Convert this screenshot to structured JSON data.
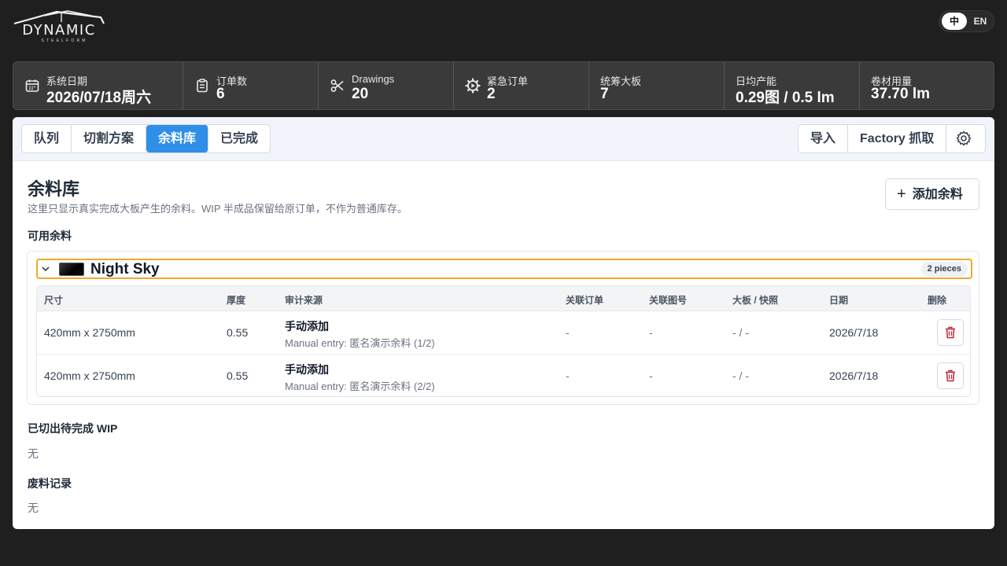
{
  "brand": {
    "name": "DYNAMIC",
    "sub": "STEELFORM"
  },
  "language": {
    "zh": "中",
    "en": "EN",
    "selected": "中"
  },
  "stats": [
    {
      "label": "系统日期",
      "value": "2026/07/18周六",
      "icon": "calendar-icon"
    },
    {
      "label": "订单数",
      "value": "6",
      "icon": "clipboard-icon"
    },
    {
      "label": "Drawings",
      "value": "20",
      "icon": "scissors-icon"
    },
    {
      "label": "紧急订单",
      "value": "2",
      "icon": "alert-gear-icon"
    },
    {
      "label": "统筹大板",
      "value": "7",
      "icon": ""
    },
    {
      "label": "日均产能",
      "value": "0.29图 / 0.5 lm",
      "icon": ""
    },
    {
      "label": "卷材用量",
      "value": "37.70 lm",
      "icon": ""
    }
  ],
  "tabs": [
    {
      "label": "队列",
      "active": false
    },
    {
      "label": "切割方案",
      "active": false
    },
    {
      "label": "余料库",
      "active": true
    },
    {
      "label": "已完成",
      "active": false
    }
  ],
  "actions": {
    "import": "导入",
    "factory": "Factory 抓取",
    "settings_icon": "gear-icon"
  },
  "page": {
    "title": "余料库",
    "description": "这里只显示真实完成大板产生的余料。WIP 半成品保留给原订单，不作为普通库存。",
    "add_button": "添加余料"
  },
  "available": {
    "heading": "可用余料",
    "groups": [
      {
        "name": "Night Sky",
        "count": "2 pieces",
        "swatch_color": "#000000",
        "columns": [
          "尺寸",
          "厚度",
          "审计来源",
          "关联订单",
          "关联图号",
          "大板 / 快照",
          "日期",
          "删除"
        ],
        "rows": [
          {
            "size": "420mm x 2750mm",
            "thickness": "0.55",
            "source": "手动添加",
            "source_detail": "Manual entry: 匿名演示余料 (1/2)",
            "order": "-",
            "drawing": "-",
            "board": "- / -",
            "date": "2026/7/18"
          },
          {
            "size": "420mm x 2750mm",
            "thickness": "0.55",
            "source": "手动添加",
            "source_detail": "Manual entry: 匿名演示余料 (2/2)",
            "order": "-",
            "drawing": "-",
            "board": "- / -",
            "date": "2026/7/18"
          }
        ]
      }
    ]
  },
  "wip": {
    "heading": "已切出待完成 WIP",
    "empty": "无"
  },
  "scrap": {
    "heading": "废料记录",
    "empty": "无"
  },
  "colors": {
    "accent": "#2f8fe8",
    "highlight_border": "#f0a830",
    "delete": "#c0263a"
  }
}
